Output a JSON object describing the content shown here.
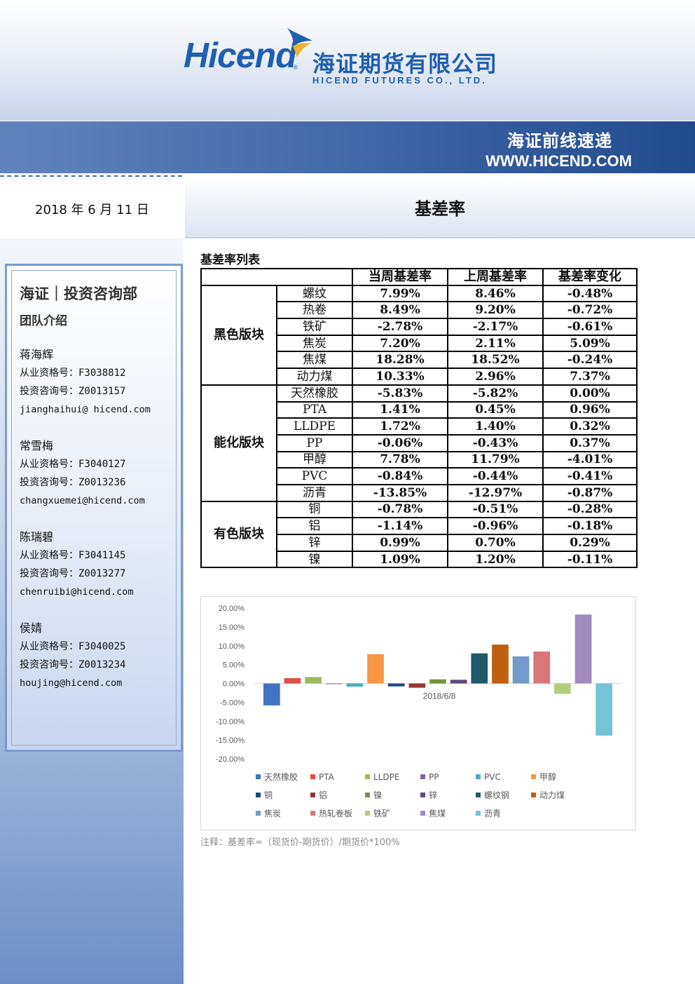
{
  "header": {
    "logo_en": "Hicend",
    "logo_reg": "®",
    "logo_cn": "海证期货有限公司",
    "logo_sub": "HICEND  FUTURES  CO.,  LTD.",
    "banner_title": "海证前线速递",
    "banner_url": "WWW.HICEND.COM"
  },
  "date": "2018 年 6 月 11 日",
  "page_title": "基差率",
  "sidebar": {
    "dept": "海证｜投资咨询部",
    "team_intro": "团队介绍",
    "members": [
      {
        "name": "蒋海辉",
        "license": "从业资格号：F3038812",
        "advisory": "投资咨询号：Z0013157",
        "email": "jianghaihui@ hicend.com"
      },
      {
        "name": "常雪梅",
        "license": "从业资格号：F3040127",
        "advisory": "投资咨询号：Z0013236",
        "email": "changxuemei@hicend.com"
      },
      {
        "name": "陈瑞碧",
        "license": "从业资格号：F3041145",
        "advisory": "投资咨询号：Z0013277",
        "email": "chenruibi@hicend.com"
      },
      {
        "name": "侯婧",
        "license": "从业资格号：F3040025",
        "advisory": "投资咨询号：Z0013234",
        "email": "houjing@hicend.com"
      }
    ]
  },
  "table": {
    "title": "基差率列表",
    "headers": [
      "",
      "",
      "当周基差率",
      "上周基差率",
      "基差率变化"
    ],
    "groups": [
      {
        "name": "黑色版块",
        "rows": [
          [
            "螺纹",
            "7.99%",
            "8.46%",
            "-0.48%"
          ],
          [
            "热卷",
            "8.49%",
            "9.20%",
            "-0.72%"
          ],
          [
            "铁矿",
            "-2.78%",
            "-2.17%",
            "-0.61%"
          ],
          [
            "焦炭",
            "7.20%",
            "2.11%",
            "5.09%"
          ],
          [
            "焦煤",
            "18.28%",
            "18.52%",
            "-0.24%"
          ],
          [
            "动力煤",
            "10.33%",
            "2.96%",
            "7.37%"
          ]
        ]
      },
      {
        "name": "能化版块",
        "rows": [
          [
            "天然橡胶",
            "-5.83%",
            "-5.82%",
            "0.00%"
          ],
          [
            "PTA",
            "1.41%",
            "0.45%",
            "0.96%"
          ],
          [
            "LLDPE",
            "1.72%",
            "1.40%",
            "0.32%"
          ],
          [
            "PP",
            "-0.06%",
            "-0.43%",
            "0.37%"
          ],
          [
            "甲醇",
            "7.78%",
            "11.79%",
            "-4.01%"
          ],
          [
            "PVC",
            "-0.84%",
            "-0.44%",
            "-0.41%"
          ],
          [
            "沥青",
            "-13.85%",
            "-12.97%",
            "-0.87%"
          ]
        ]
      },
      {
        "name": "有色版块",
        "rows": [
          [
            "铜",
            "-0.78%",
            "-0.51%",
            "-0.28%"
          ],
          [
            "铝",
            "-1.14%",
            "-0.96%",
            "-0.18%"
          ],
          [
            "锌",
            "0.99%",
            "0.70%",
            "0.29%"
          ],
          [
            "镍",
            "1.09%",
            "1.20%",
            "-0.11%"
          ]
        ]
      }
    ]
  },
  "chart_data": {
    "type": "bar",
    "categories": [
      "2018/6/8"
    ],
    "ylim": [
      -0.2,
      0.2
    ],
    "yticks": [
      "20.00%",
      "15.00%",
      "10.00%",
      "5.00%",
      "0.00%",
      "-5.00%",
      "-10.00%",
      "-15.00%",
      "-20.00%"
    ],
    "series": [
      {
        "name": "天然橡胶",
        "value": -0.0583,
        "color": "#4472c4"
      },
      {
        "name": "PTA",
        "value": 0.0141,
        "color": "#e04b4b"
      },
      {
        "name": "LLDPE",
        "value": 0.0172,
        "color": "#9bbb59"
      },
      {
        "name": "PP",
        "value": -0.0006,
        "color": "#8064a2"
      },
      {
        "name": "PVC",
        "value": -0.0084,
        "color": "#4bacc6"
      },
      {
        "name": "甲醇",
        "value": 0.0778,
        "color": "#f79646"
      },
      {
        "name": "铜",
        "value": -0.0078,
        "color": "#1f497d"
      },
      {
        "name": "铝",
        "value": -0.0114,
        "color": "#943634"
      },
      {
        "name": "镍",
        "value": 0.0109,
        "color": "#76923c"
      },
      {
        "name": "锌",
        "value": 0.0099,
        "color": "#5f497a"
      },
      {
        "name": "螺纹钢",
        "value": 0.0799,
        "color": "#215968"
      },
      {
        "name": "动力煤",
        "value": 0.1033,
        "color": "#c0600f"
      },
      {
        "name": "焦炭",
        "value": 0.072,
        "color": "#729aca"
      },
      {
        "name": "热轧卷板",
        "value": 0.0849,
        "color": "#d7777a"
      },
      {
        "name": "铁矿",
        "value": -0.0278,
        "color": "#b3cd7f"
      },
      {
        "name": "焦煤",
        "value": 0.1828,
        "color": "#a08cc0"
      },
      {
        "name": "沥青",
        "value": -0.1385,
        "color": "#76c2d6"
      }
    ]
  },
  "note": "注释：基差率=（现货价-期货价）/期货价*100%"
}
